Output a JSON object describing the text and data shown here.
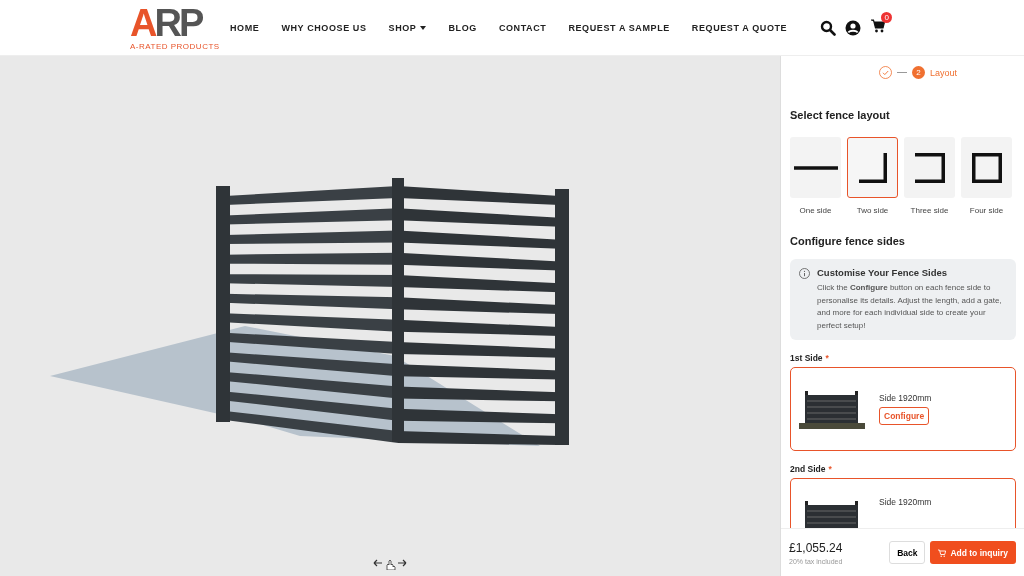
{
  "header": {
    "logo": {
      "letters": "ARP",
      "tagline": "A-RATED PRODUCTS"
    },
    "nav": [
      {
        "label": "HOME",
        "dropdown": false
      },
      {
        "label": "WHY CHOOSE US",
        "dropdown": false
      },
      {
        "label": "SHOP",
        "dropdown": true
      },
      {
        "label": "BLOG",
        "dropdown": false
      },
      {
        "label": "CONTACT",
        "dropdown": false
      },
      {
        "label": "REQUEST A SAMPLE",
        "dropdown": false
      },
      {
        "label": "REQUEST A QUOTE",
        "dropdown": false
      }
    ],
    "cart_count": "0"
  },
  "stepper": [
    {
      "kind": "done"
    },
    {
      "kind": "current",
      "number": "2",
      "label": "Layout"
    }
  ],
  "layout": {
    "title": "Select fence layout",
    "options": [
      {
        "kind": "one",
        "label": "One side",
        "selected": false
      },
      {
        "kind": "two",
        "label": "Two side",
        "selected": true
      },
      {
        "kind": "three",
        "label": "Three side",
        "selected": false
      },
      {
        "kind": "four",
        "label": "Four side",
        "selected": false
      }
    ]
  },
  "configure": {
    "title": "Configure fence sides",
    "info": {
      "title": "Customise Your Fence Sides",
      "text": "Click the **Configure** button on each fence side to personalise its details. Adjust the length, add a gate, and more for each individual side to create your perfect setup!"
    },
    "sides": [
      {
        "label": "1st Side",
        "required_mark": "*",
        "length": "Side 1920mm",
        "button": "Configure"
      },
      {
        "label": "2nd Side",
        "required_mark": "*",
        "length": "Side 1920mm"
      }
    ]
  },
  "footer": {
    "price": "£1,055.24",
    "tax": "20% tax included",
    "back": "Back",
    "add": "Add to inquiry"
  }
}
